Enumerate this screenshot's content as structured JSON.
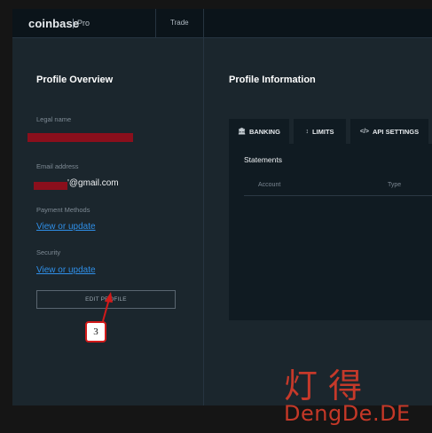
{
  "header": {
    "logo": "coinbase",
    "logo_sub": "Pro",
    "nav_trade": "Trade"
  },
  "profile_overview": {
    "title": "Profile Overview",
    "legal_name_label": "Legal name",
    "email_label": "Email address",
    "email_value": "'@gmail.com",
    "payment_label": "Payment Methods",
    "payment_link": "View or update",
    "security_label": "Security",
    "security_link": "View or update",
    "edit_button": "EDIT PROFILE"
  },
  "profile_information": {
    "title": "Profile Information",
    "tabs": [
      {
        "label": "BANKING",
        "icon": "bank-icon"
      },
      {
        "label": "LIMITS",
        "icon": "limits-icon"
      },
      {
        "label": "API SETTINGS",
        "icon": "code-icon"
      }
    ],
    "statements": {
      "title": "Statements",
      "columns": [
        "Account",
        "Type"
      ]
    }
  },
  "annotation": {
    "step_number": "3"
  },
  "watermark": {
    "chinese": "灯 得",
    "latin": "DengDe.DE"
  },
  "colors": {
    "link": "#2f8fe8",
    "redaction": "#8b0f1c",
    "annotation_red": "#d21a1a",
    "watermark": "#d93c2a"
  }
}
